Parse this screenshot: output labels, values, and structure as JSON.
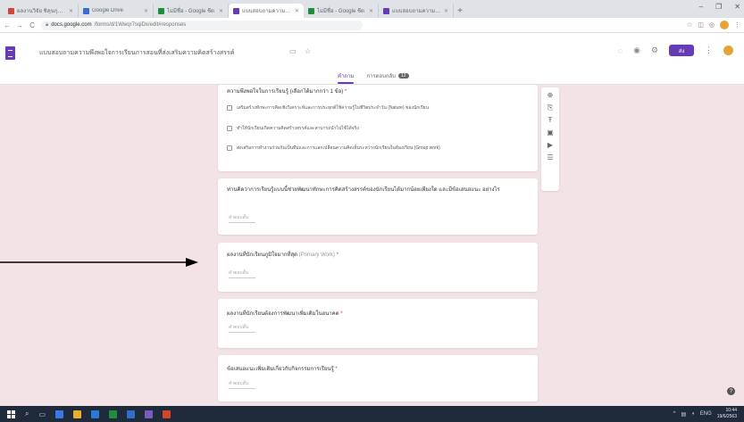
{
  "browser": {
    "tabs": [
      {
        "title": "ผลงานวิจัย ชิคุนกุนยา (โรค) ไปรษณีย์",
        "fav": "#d0473a",
        "active": false
      },
      {
        "title": "Google Drive",
        "fav": "#3b6bd6",
        "active": false
      },
      {
        "title": "ไม่มีชื่อ - Google ชีต",
        "fav": "#1e8e3e",
        "active": false
      },
      {
        "title": "แบบสอบถามความพึงพอใจ",
        "fav": "#673ab7",
        "active": true
      },
      {
        "title": "ไม่มีชื่อ - Google ชีต",
        "fav": "#1e8e3e",
        "active": false
      },
      {
        "title": "แบบสอบถามความพึงพอใจ",
        "fav": "#673ab7",
        "active": false
      }
    ],
    "new_tab": "+",
    "window_controls": [
      "–",
      "❐",
      "✕"
    ],
    "nav": {
      "back": "←",
      "forward": "→",
      "reload": "C"
    },
    "address": {
      "host": "docs.google.com",
      "path": "/forms/d/1Wwqr7sqiDx/edit#responses"
    }
  },
  "form": {
    "title": "แบบสอบถามความพึงพอใจการเรียนการสอนที่ส่งเสริมความคิดสร้างสรรค์",
    "send_label": "ส่ง",
    "tabs": [
      {
        "label": "คำถาม",
        "active": true
      },
      {
        "label": "การตอบกลับ",
        "badge": "12",
        "active": false
      }
    ],
    "cards": [
      {
        "title": "ความพึงพอใจในการเรียนรู้ (เลือกได้มากกว่า 1 ข้อ)",
        "required": true,
        "options": [
          "เสริมสร้างทักษะการคิดเชิงวิเคราะห์และการประยุกต์ใช้ความรู้ในชีวิตประจำวัน (Nature) ของนักเรียน",
          "ทำให้นักเรียนเกิดความคิดสร้างสรรค์และสามารถนำไปใช้ได้จริง",
          "ส่งเสริมการทำงานร่วมกันเป็นทีมและการแลกเปลี่ยนความคิดเห็นระหว่างนักเรียนในห้องเรียน (Group work)"
        ]
      },
      {
        "title": "ท่านคิดว่าการเรียนรู้แบบนี้ช่วยพัฒนาทักษะการคิดสร้างสรรค์ของนักเรียนได้มากน้อยเพียงใด และมีข้อเสนอแนะ อย่างไร",
        "required": false,
        "answer_hint": "คำตอบสั้น"
      },
      {
        "title": "ผลงานที่นักเรียนภูมิใจมากที่สุด",
        "title_hint": "(Primary Work)",
        "required": true,
        "answer_hint": "คำตอบสั้น"
      },
      {
        "title": "ผลงานที่นักเรียนต้องการพัฒนาเพิ่มเติมในอนาคต",
        "required": true,
        "answer_hint": "คำตอบสั้น"
      },
      {
        "title": "ข้อเสนอแนะเพิ่มเติมเกี่ยวกับกิจกรรมการเรียนรู้",
        "required": true,
        "answer_hint": "คำตอบสั้น"
      }
    ]
  },
  "toolbar_icons": [
    "add-question-icon",
    "import-icon",
    "title-icon",
    "image-icon",
    "video-icon",
    "section-icon"
  ],
  "help": "?",
  "taskbar": {
    "apps": [
      "#3b78e7",
      "#e8b02a",
      "#2b7bd6",
      "#1e8e3e",
      "#2f6dd0",
      "#7a5cbd",
      "#d24726"
    ],
    "clock_time": "10:44",
    "clock_date": "19/6/2563",
    "lang": "ENG"
  },
  "colors": {
    "accent": "#673ab7",
    "page_bg": "#f3e3e6",
    "required": "#d93025"
  }
}
